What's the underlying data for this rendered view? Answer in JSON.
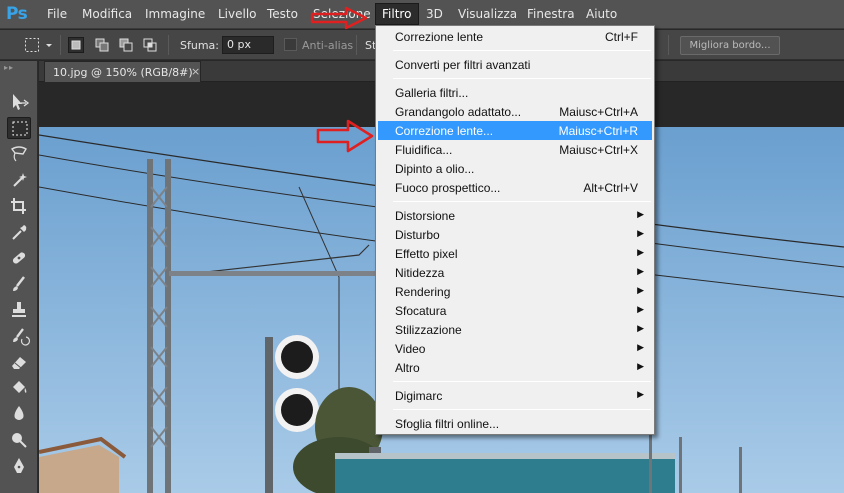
{
  "app": {
    "logo": "Ps",
    "menus": [
      "File",
      "Modifica",
      "Immagine",
      "Livello",
      "Testo",
      "Selezione",
      "Filtro",
      "3D",
      "Visualizza",
      "Finestra",
      "Aiuto"
    ]
  },
  "options_bar": {
    "sfuma_label": "Sfuma:",
    "sfuma_value": "0 px",
    "antialias_label": "Anti-alias",
    "stile_label": "St",
    "migliora_label": "Migliora bordo..."
  },
  "document": {
    "tab_label": "10.jpg @ 150% (RGB/8#)",
    "close_glyph": "×"
  },
  "filter_menu": {
    "last_filter": {
      "label": "Correzione lente",
      "shortcut": "Ctrl+F"
    },
    "smart": {
      "label": "Converti per filtri avanzati"
    },
    "group1": [
      {
        "label": "Galleria filtri...",
        "shortcut": ""
      },
      {
        "label": "Grandangolo adattato...",
        "shortcut": "Maiusc+Ctrl+A"
      },
      {
        "label": "Correzione lente...",
        "shortcut": "Maiusc+Ctrl+R",
        "highlighted": true
      },
      {
        "label": "Fluidifica...",
        "shortcut": "Maiusc+Ctrl+X"
      },
      {
        "label": "Dipinto a olio...",
        "shortcut": ""
      },
      {
        "label": "Fuoco prospettico...",
        "shortcut": "Alt+Ctrl+V"
      }
    ],
    "group2": [
      {
        "label": "Distorsione"
      },
      {
        "label": "Disturbo"
      },
      {
        "label": "Effetto pixel"
      },
      {
        "label": "Nitidezza"
      },
      {
        "label": "Rendering"
      },
      {
        "label": "Sfocatura"
      },
      {
        "label": "Stilizzazione"
      },
      {
        "label": "Video"
      },
      {
        "label": "Altro"
      }
    ],
    "digimarc": {
      "label": "Digimarc"
    },
    "online": {
      "label": "Sfoglia filtri online..."
    }
  },
  "colors": {
    "highlight": "#3399ff",
    "annotation_arrow": "#e02020",
    "ps_blue": "#38a3e6"
  }
}
